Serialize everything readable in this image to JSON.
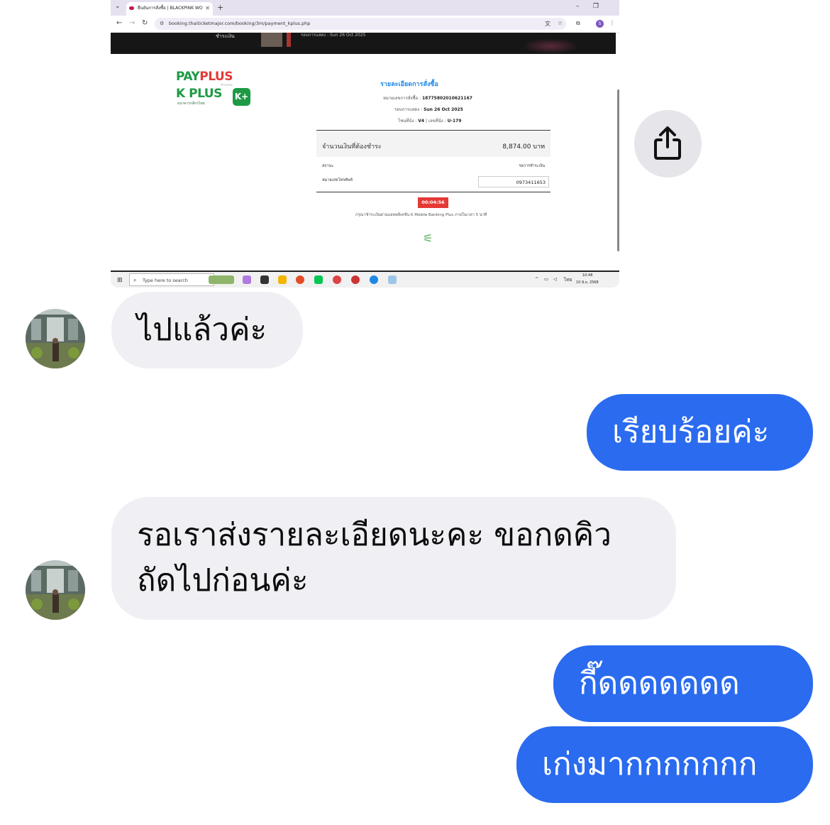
{
  "browser": {
    "tab_title": "ยืนยันการสั่งซื้อ | BLACKPINK WO",
    "url": "booking.thaiticketmajor.com/booking/3m/payment_kplus.php",
    "profile_initial": "S"
  },
  "page_banner": {
    "left_label": "ชำระเงิน",
    "date_label": "รอบการแสดง : Sun 26 Oct 2025"
  },
  "logo": {
    "payplus_pay": "PAY",
    "payplus_plus": "PLUS",
    "payplus_sub": "ชำระผ่าน",
    "kplus_k": "K",
    "kplus_plus": "PLUS",
    "kplus_box": "K+",
    "bank_name": "ธนาคารกสิกรไทย"
  },
  "order": {
    "title": "รายละเอียดการสั่งซื้อ",
    "order_no_label": "หมายเลขการสั่งซื้อ :",
    "order_no": "18775802010621167",
    "show_label": "รอบการแสดง :",
    "show_date": "Sun 26 Oct 2025",
    "zone_label": "โซนที่นั่ง :",
    "zone": "V4",
    "seat_label": "เลขที่นั่ง :",
    "seat": "U-179"
  },
  "payment": {
    "amount_label": "จำนวนเงินที่ต้องชำระ",
    "amount": "8,874.00 บาท",
    "status_label": "สถานะ",
    "status_value": "รอการชำระเงิน",
    "phone_label": "หมายเลขโทรศัพท์",
    "phone_value": "0973411653",
    "timer": "00:04:56",
    "note": "กรุณาชำระเงินผ่านแอพพลิเคชั่น K Mobile Banking Plus ภายในเวลา 5 นาที"
  },
  "taskbar": {
    "search_placeholder": "Type here to search",
    "lang": "ไทย",
    "time": "10:48",
    "date": "10 มิ.ย. 2568"
  },
  "messages": [
    {
      "side": "incoming",
      "text": "ไปแล้วค่ะ"
    },
    {
      "side": "outgoing",
      "text": "เรียบร้อยค่ะ"
    },
    {
      "side": "incoming",
      "text": "รอเราส่งรายละเอียดนะคะ ขอกดคิวถัดไปก่อนค่ะ"
    },
    {
      "side": "outgoing",
      "text": "กี๊ดดดดดดด"
    },
    {
      "side": "outgoing",
      "text": "เก่งมากกกกกกก"
    }
  ],
  "colors": {
    "outgoing_bubble": "#2a6bef",
    "incoming_bubble": "#f0f0f4",
    "timer": "#e53935",
    "kplus_green": "#1e9a45",
    "order_title": "#1e88e5"
  }
}
